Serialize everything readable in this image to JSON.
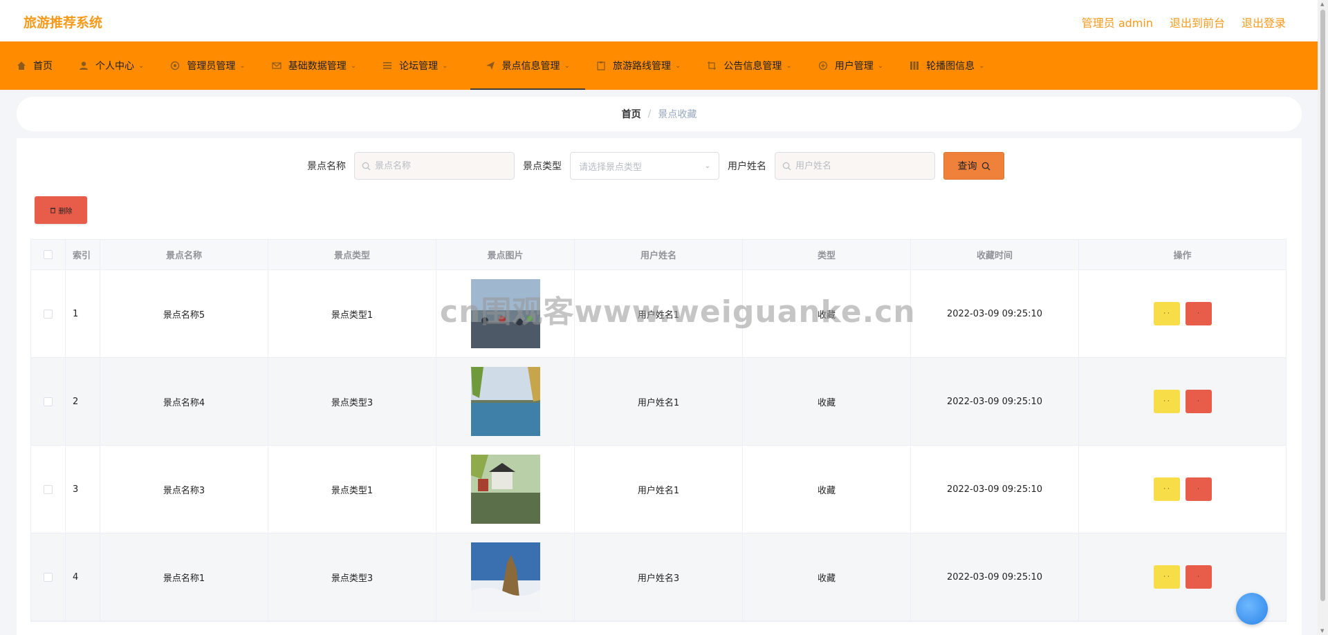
{
  "app": {
    "title": "旅游推荐系统",
    "top_links": [
      "管理员 admin",
      "退出到前台",
      "退出登录"
    ]
  },
  "nav": [
    {
      "label": "首页",
      "icon": "home-icon",
      "has_menu": false
    },
    {
      "label": "个人中心",
      "icon": "user-icon",
      "has_menu": true
    },
    {
      "label": "管理员管理",
      "icon": "admin-icon",
      "has_menu": true
    },
    {
      "label": "基础数据管理",
      "icon": "mail-icon",
      "has_menu": true
    },
    {
      "label": "论坛管理",
      "icon": "list-icon",
      "has_menu": true
    },
    {
      "label": "景点信息管理",
      "icon": "send-icon",
      "has_menu": true,
      "active": true
    },
    {
      "label": "旅游路线管理",
      "icon": "clipboard-icon",
      "has_menu": true
    },
    {
      "label": "公告信息管理",
      "icon": "crop-icon",
      "has_menu": true
    },
    {
      "label": "用户管理",
      "icon": "users-icon",
      "has_menu": true
    },
    {
      "label": "轮播图信息",
      "icon": "grid-icon",
      "has_menu": true
    }
  ],
  "breadcrumb": {
    "home": "首页",
    "separator": "/",
    "current": "景点收藏"
  },
  "search": {
    "name_label": "景点名称",
    "name_placeholder": "景点名称",
    "type_label": "景点类型",
    "type_placeholder": "请选择景点类型",
    "user_label": "用户姓名",
    "user_placeholder": "用户姓名",
    "query_label": "查询"
  },
  "toolbar": {
    "delete_label": "删除"
  },
  "table": {
    "headers": [
      "索引",
      "景点名称",
      "景点类型",
      "景点图片",
      "用户姓名",
      "类型",
      "收藏时间",
      "操作"
    ],
    "rows": [
      {
        "index": "1",
        "name": "景点名称5",
        "type": "景点类型1",
        "user": "用户姓名1",
        "kind": "收藏",
        "time": "2022-03-09 09:25:10"
      },
      {
        "index": "2",
        "name": "景点名称4",
        "type": "景点类型3",
        "user": "用户姓名1",
        "kind": "收藏",
        "time": "2022-03-09 09:25:10"
      },
      {
        "index": "3",
        "name": "景点名称3",
        "type": "景点类型1",
        "user": "用户姓名1",
        "kind": "收藏",
        "time": "2022-03-09 09:25:10"
      },
      {
        "index": "4",
        "name": "景点名称1",
        "type": "景点类型3",
        "user": "用户姓名3",
        "kind": "收藏",
        "time": "2022-03-09 09:25:10"
      }
    ],
    "op_edit_label": "· ·",
    "op_delete_label": "·"
  },
  "watermark": "cn围观客www.weiguanke.cn",
  "colors": {
    "brand": "#f59a1b",
    "nav_bg": "#ff8c00",
    "query_btn": "#f0813a",
    "delete_btn": "#e85d4a",
    "edit_btn": "#f7dd48"
  }
}
